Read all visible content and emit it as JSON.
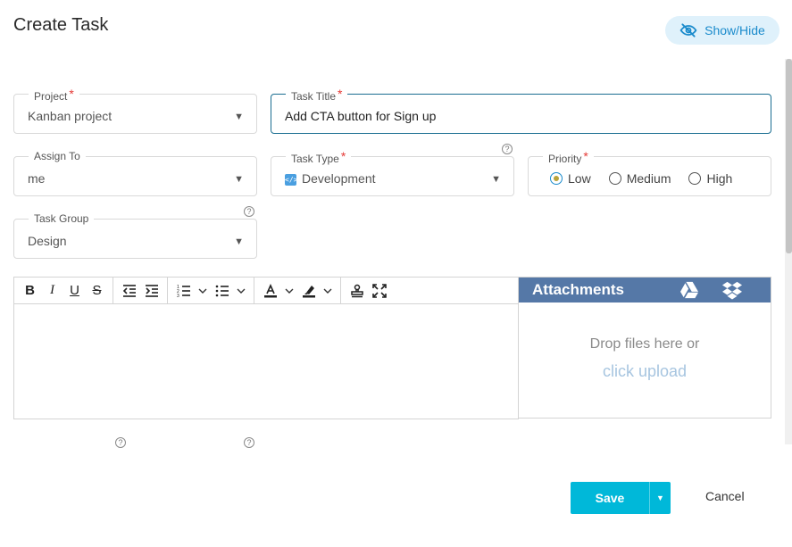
{
  "page": {
    "title": "Create Task"
  },
  "header": {
    "show_hide_label": "Show/Hide",
    "show_hide_icon": "eye-slash-icon",
    "accent": "#1a8bcc"
  },
  "form": {
    "project": {
      "label": "Project",
      "required": "*",
      "value": "Kanban project"
    },
    "task_title": {
      "label": "Task Title",
      "required": "*",
      "value": "Add CTA button for Sign up"
    },
    "assign_to": {
      "label": "Assign To",
      "value": "me"
    },
    "task_type": {
      "label": "Task Type",
      "required": "*",
      "value": "Development",
      "icon": "code-icon"
    },
    "priority": {
      "label": "Priority",
      "required": "*",
      "options": [
        {
          "label": "Low",
          "checked": true
        },
        {
          "label": "Medium",
          "checked": false
        },
        {
          "label": "High",
          "checked": false
        }
      ]
    },
    "task_group": {
      "label": "Task Group",
      "value": "Design"
    },
    "help_glyph": "?",
    "caret_glyph": "▼"
  },
  "editor": {
    "toolbar_groups": [
      [
        "bold-icon",
        "italic-icon",
        "underline-icon",
        "strikethrough-icon"
      ],
      [
        "outdent-icon",
        "indent-icon"
      ],
      [
        "ordered-list-icon",
        "unordered-list-icon"
      ],
      [
        "font-color-icon",
        "highlight-icon"
      ],
      [
        "stamp-icon",
        "fullscreen-icon"
      ]
    ]
  },
  "attachments": {
    "title": "Attachments",
    "drop_text": "Drop files here or",
    "upload_link": "click upload",
    "header_color": "#5578a7"
  },
  "footer": {
    "save_label": "Save",
    "cancel_label": "Cancel",
    "save_color": "#00b8d9"
  }
}
